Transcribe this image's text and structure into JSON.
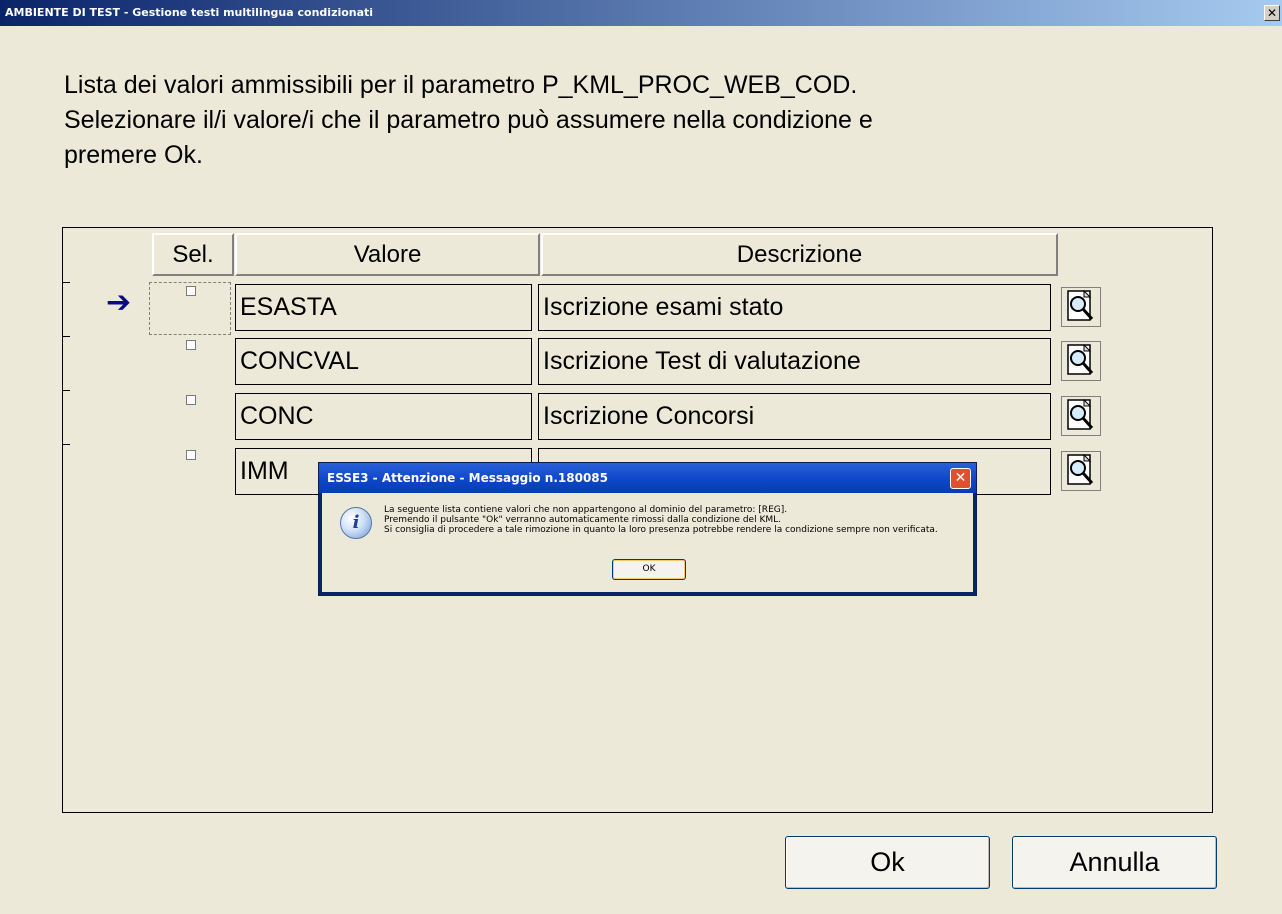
{
  "window": {
    "title": "AMBIENTE DI TEST - Gestione testi multilingua condizionati",
    "close_glyph": "✕"
  },
  "instructions": {
    "line1": "Lista dei valori ammissibili per il parametro P_KML_PROC_WEB_COD.",
    "line2": "Selezionare il/i valore/i che il parametro può assumere nella condizione e",
    "line3": "premere Ok."
  },
  "table": {
    "headers": {
      "sel": "Sel.",
      "valore": "Valore",
      "descrizione": "Descrizione"
    },
    "rows": [
      {
        "valore": "ESASTA",
        "descrizione": "Iscrizione esami stato",
        "selected": false,
        "current": true
      },
      {
        "valore": "CONCVAL",
        "descrizione": "Iscrizione Test di valutazione",
        "selected": false,
        "current": false
      },
      {
        "valore": "CONC",
        "descrizione": "Iscrizione Concorsi",
        "selected": false,
        "current": false
      },
      {
        "valore": "IMM",
        "descrizione": "",
        "selected": false,
        "current": false
      }
    ],
    "current_row_arrow": "➔",
    "row_action_icon": "zoom-detail-icon"
  },
  "buttons": {
    "ok": "Ok",
    "cancel": "Annulla"
  },
  "modal": {
    "title": "ESSE3 - Attenzione  - Messaggio n.180085",
    "icon": "info-icon",
    "icon_glyph": "i",
    "close_glyph": "✕",
    "line1": "La seguente lista contiene valori che non appartengono al dominio del parametro: [REG].",
    "line2": "Premendo il pulsante \"Ok\" verranno automaticamente rimossi dalla condizione del KML.",
    "line3": "Si consiglia di procedere a tale rimozione in quanto la loro presenza potrebbe rendere la condizione sempre non verificata.",
    "ok_label": "OK"
  }
}
